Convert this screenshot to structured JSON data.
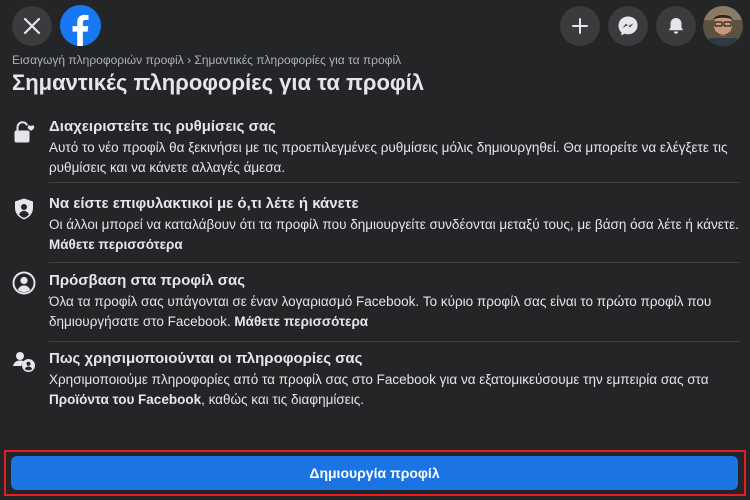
{
  "header": {
    "close_icon": "close-icon",
    "logo_icon": "facebook-logo-icon",
    "brand_color": "#1877f2",
    "actions": [
      "plus-icon",
      "messenger-icon",
      "bell-icon"
    ]
  },
  "breadcrumb": {
    "parent": "Εισαγωγή πληροφοριών προφίλ",
    "separator": "›",
    "current": "Σημαντικές πληροφορίες για τα προφίλ"
  },
  "page_title": "Σημαντικές πληροφορίες για τα προφίλ",
  "sections": [
    {
      "icon": "lock-heart-icon",
      "title": "Διαχειριστείτε τις ρυθμίσεις σας",
      "body": "Αυτό το νέο προφίλ θα ξεκινήσει με τις προεπιλεγμένες ρυθμίσεις μόλις δημιουργηθεί. Θα μπορείτε να ελέγξετε τις ρυθμίσεις και να κάνετε αλλαγές άμεσα.",
      "link": ""
    },
    {
      "icon": "shield-person-icon",
      "title": "Να είστε επιφυλακτικοί με ό,τι λέτε ή κάνετε",
      "body": "Οι άλλοι μπορεί να καταλάβουν ότι τα προφίλ που δημιουργείτε συνδέονται μεταξύ τους, με βάση όσα λέτε ή κάνετε.",
      "link": "Μάθετε περισσότερα"
    },
    {
      "icon": "person-circle-icon",
      "title": "Πρόσβαση στα προφίλ σας",
      "body": "Όλα τα προφίλ σας υπάγονται σε έναν λογαριασμό Facebook. Το κύριο προφίλ σας είναι το πρώτο προφίλ που δημιουργήσατε στο Facebook.",
      "link": "Μάθετε περισσότερα"
    },
    {
      "icon": "people-settings-icon",
      "title": "Πως χρησιμοποιούνται οι πληροφορίες σας",
      "body_before": "Χρησιμοποιούμε πληροφορίες από τα προφίλ σας στο Facebook για να εξατομικεύσουμε την εμπειρία σας στα",
      "body_bold": "Προϊόντα του Facebook",
      "body_after": ", καθώς και τις διαφημίσεις."
    }
  ],
  "cta": {
    "label": "Δημιουργία προφίλ",
    "color": "#1b74e4",
    "highlight_color": "#e41e26"
  }
}
